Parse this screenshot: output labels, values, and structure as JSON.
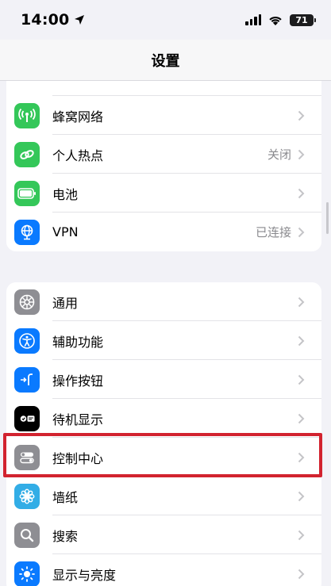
{
  "status_bar": {
    "time": "14:00",
    "battery": "71"
  },
  "nav": {
    "title": "设置"
  },
  "group1": {
    "items": [
      {
        "label": "蜂窝网络",
        "value": "",
        "icon": "antenna-icon",
        "color": "#34c759"
      },
      {
        "label": "个人热点",
        "value": "关闭",
        "icon": "link-icon",
        "color": "#34c759"
      },
      {
        "label": "电池",
        "value": "",
        "icon": "battery-icon",
        "color": "#34c759"
      },
      {
        "label": "VPN",
        "value": "已连接",
        "icon": "globe-icon",
        "color": "#0a7aff"
      }
    ]
  },
  "group2": {
    "items": [
      {
        "label": "通用",
        "icon": "gear-icon",
        "color": "#8e8e93"
      },
      {
        "label": "辅助功能",
        "icon": "accessibility-icon",
        "color": "#0a7aff"
      },
      {
        "label": "操作按钮",
        "icon": "action-button-icon",
        "color": "#0a7aff"
      },
      {
        "label": "待机显示",
        "icon": "standby-icon",
        "color": "#000000"
      },
      {
        "label": "控制中心",
        "icon": "toggles-icon",
        "color": "#8e8e93"
      },
      {
        "label": "墙纸",
        "icon": "flower-icon",
        "color": "#32ade6"
      },
      {
        "label": "搜索",
        "icon": "search-icon",
        "color": "#8e8e93"
      },
      {
        "label": "显示与亮度",
        "icon": "sun-icon",
        "color": "#0a7aff"
      }
    ]
  }
}
